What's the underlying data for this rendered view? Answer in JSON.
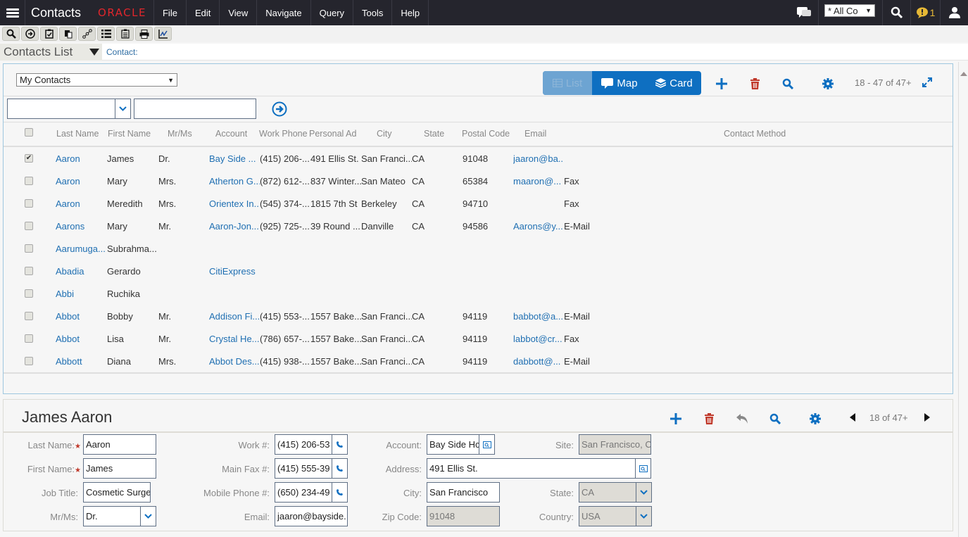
{
  "topbar": {
    "app_title": "Contacts",
    "logo": "ORACLE",
    "menus": [
      "File",
      "Edit",
      "View",
      "Navigate",
      "Query",
      "Tools",
      "Help"
    ],
    "queue_select": "* All Co",
    "notification_count": "1"
  },
  "toolbar": {
    "icons": [
      "search-icon",
      "go-icon",
      "checklist-icon",
      "copy-icon",
      "workflow-icon",
      "list-icon",
      "clipboard-icon",
      "print-icon",
      "chart-icon"
    ]
  },
  "viewbar": {
    "view_name": "Contacts List",
    "breadcrumb": "Contact:"
  },
  "list_applet": {
    "visibility_filter": "My Contacts",
    "view_modes": {
      "list": "List",
      "map": "Map",
      "card": "Card"
    },
    "record_count": "18 - 47 of 47+",
    "query_field_value": "",
    "query_text_value": "",
    "columns": [
      "Last Name",
      "First Name",
      "Mr/Ms",
      "Account",
      "Work Phone",
      "Personal Ad",
      "City",
      "State",
      "Postal Code",
      "Email",
      "Contact Method"
    ],
    "rows": [
      {
        "checked": true,
        "last": "Aaron",
        "first": "James",
        "mrms": "Dr.",
        "account": "Bay Side ...",
        "phone": "(415) 206-...",
        "address": "491 Ellis St.",
        "city": "San Franci...",
        "state": "CA",
        "zip": "91048",
        "email": "jaaron@ba...",
        "method": ""
      },
      {
        "checked": false,
        "last": "Aaron",
        "first": "Mary",
        "mrms": "Mrs.",
        "account": "Atherton G...",
        "phone": "(872) 612-...",
        "address": "837 Winter...",
        "city": "San Mateo",
        "state": "CA",
        "zip": "65384",
        "email": "maaron@...",
        "method": "Fax"
      },
      {
        "checked": false,
        "last": "Aaron",
        "first": "Meredith",
        "mrms": "Mrs.",
        "account": "Orientex In...",
        "phone": "(545) 374-...",
        "address": "1815 7th St",
        "city": "Berkeley",
        "state": "CA",
        "zip": "94710",
        "email": "",
        "method": "Fax"
      },
      {
        "checked": false,
        "last": "Aarons",
        "first": "Mary",
        "mrms": "Mr.",
        "account": "Aaron-Jon...",
        "phone": "(925) 725-...",
        "address": "39 Round ...",
        "city": "Danville",
        "state": "CA",
        "zip": "94586",
        "email": "Aarons@y...",
        "method": "E-Mail"
      },
      {
        "checked": false,
        "last": "Aarumuga...",
        "first": "Subrahma...",
        "mrms": "",
        "account": "",
        "phone": "",
        "address": "",
        "city": "",
        "state": "",
        "zip": "",
        "email": "",
        "method": ""
      },
      {
        "checked": false,
        "last": "Abadia",
        "first": "Gerardo",
        "mrms": "",
        "account": "CitiExpress",
        "phone": "",
        "address": "",
        "city": "",
        "state": "",
        "zip": "",
        "email": "",
        "method": ""
      },
      {
        "checked": false,
        "last": "Abbi",
        "first": "Ruchika",
        "mrms": "",
        "account": "",
        "phone": "",
        "address": "",
        "city": "",
        "state": "",
        "zip": "",
        "email": "",
        "method": ""
      },
      {
        "checked": false,
        "last": "Abbot",
        "first": "Bobby",
        "mrms": "Mr.",
        "account": "Addison Fi...",
        "phone": "(415) 553-...",
        "address": "1557 Bake...",
        "city": "San Franci...",
        "state": "CA",
        "zip": "94119",
        "email": "babbot@a...",
        "method": "E-Mail"
      },
      {
        "checked": false,
        "last": "Abbot",
        "first": "Lisa",
        "mrms": "Mr.",
        "account": "Crystal He...",
        "phone": "(786) 657-...",
        "address": "1557 Bake...",
        "city": "San Franci...",
        "state": "CA",
        "zip": "94119",
        "email": "labbot@cr...",
        "method": "Fax"
      },
      {
        "checked": false,
        "last": "Abbott",
        "first": "Diana",
        "mrms": "Mrs.",
        "account": "Abbot Des...",
        "phone": "(415) 938-...",
        "address": "1557 Bake...",
        "city": "San Franci...",
        "state": "CA",
        "zip": "94119",
        "email": "dabbott@...",
        "method": "E-Mail"
      }
    ]
  },
  "form_applet": {
    "title": "James Aaron",
    "record_count": "18 of 47+",
    "fields": {
      "last_name": {
        "label": "Last Name:",
        "value": "Aaron",
        "required": "★"
      },
      "first_name": {
        "label": "First Name:",
        "value": "James",
        "required": "★"
      },
      "job_title": {
        "label": "Job Title:",
        "value": "Cosmetic Surge"
      },
      "mrms": {
        "label": "Mr/Ms:",
        "value": "Dr."
      },
      "work_phone": {
        "label": "Work #:",
        "value": "(415) 206-53"
      },
      "main_fax": {
        "label": "Main Fax #:",
        "value": "(415) 555-39"
      },
      "mobile": {
        "label": "Mobile Phone #:",
        "value": "(650) 234-49"
      },
      "email": {
        "label": "Email:",
        "value": "jaaron@bayside."
      },
      "account": {
        "label": "Account:",
        "value": "Bay Side Hc"
      },
      "address": {
        "label": "Address:",
        "value": "491 Ellis St."
      },
      "city": {
        "label": "City:",
        "value": "San Francisco"
      },
      "zip": {
        "label": "Zip Code:",
        "value": "91048"
      },
      "site": {
        "label": "Site:",
        "value": "San Francisco, C"
      },
      "state": {
        "label": "State:",
        "value": "CA"
      },
      "country": {
        "label": "Country:",
        "value": "USA"
      }
    }
  },
  "colors": {
    "accent": "#0e6fc1",
    "link": "#1f6fb2",
    "delete": "#c0392b",
    "topbar": "#25252d",
    "logo": "#e0262c"
  }
}
